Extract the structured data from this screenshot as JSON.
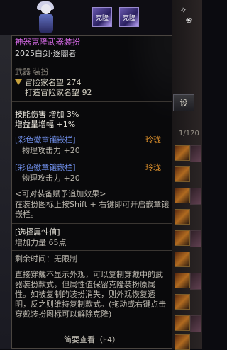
{
  "top_icons": [
    {
      "label": "克隆",
      "icon": "clone-icon"
    },
    {
      "label": "克隆",
      "icon": "clone-icon"
    }
  ],
  "background": {
    "side_button_label": "设",
    "side_count": "1/120"
  },
  "tooltip": {
    "title": "神器克隆武器装扮",
    "subtitle": "2025白剑·逐闇者",
    "slot": "武器 装扮",
    "fame_label": "冒险家名望 274",
    "fame_forge": "打造冒险家名望 92",
    "stats": {
      "skill_damage": "技能伤害 增加 3%",
      "buff_amp": "增益量增幅 +1%"
    },
    "sockets": [
      {
        "name": "[彩色徽章镶嵌栏]",
        "grade": "玲珑",
        "effect": "物理攻击力 +20"
      },
      {
        "name": "[彩色徽章镶嵌栏]",
        "grade": "玲珑",
        "effect": "物理攻击力 +20"
      }
    ],
    "attach_title": "<可对装备赋予追加效果>",
    "attach_desc": "在装扮图标上按Shift + 右键即可开启嵌章镶嵌栏。",
    "select_title": "[选择属性值]",
    "select_value": "增加力量 65点",
    "time_remaining": "剩余时间：无限制",
    "desc": "直接穿戴不显示外观，可以复制穿戴中的武器装扮款式，但属性值保留克隆装扮原属性。如被复制的装扮消失，则外观恢复透明，反之则维持复制款式。(拖动或右键点击穿戴装扮图标可以解除克隆)",
    "view_label": "简要查看（F4）"
  },
  "colors": {
    "title": "#d86be8",
    "blue": "#6f8ee8",
    "orange": "#e2932c"
  }
}
